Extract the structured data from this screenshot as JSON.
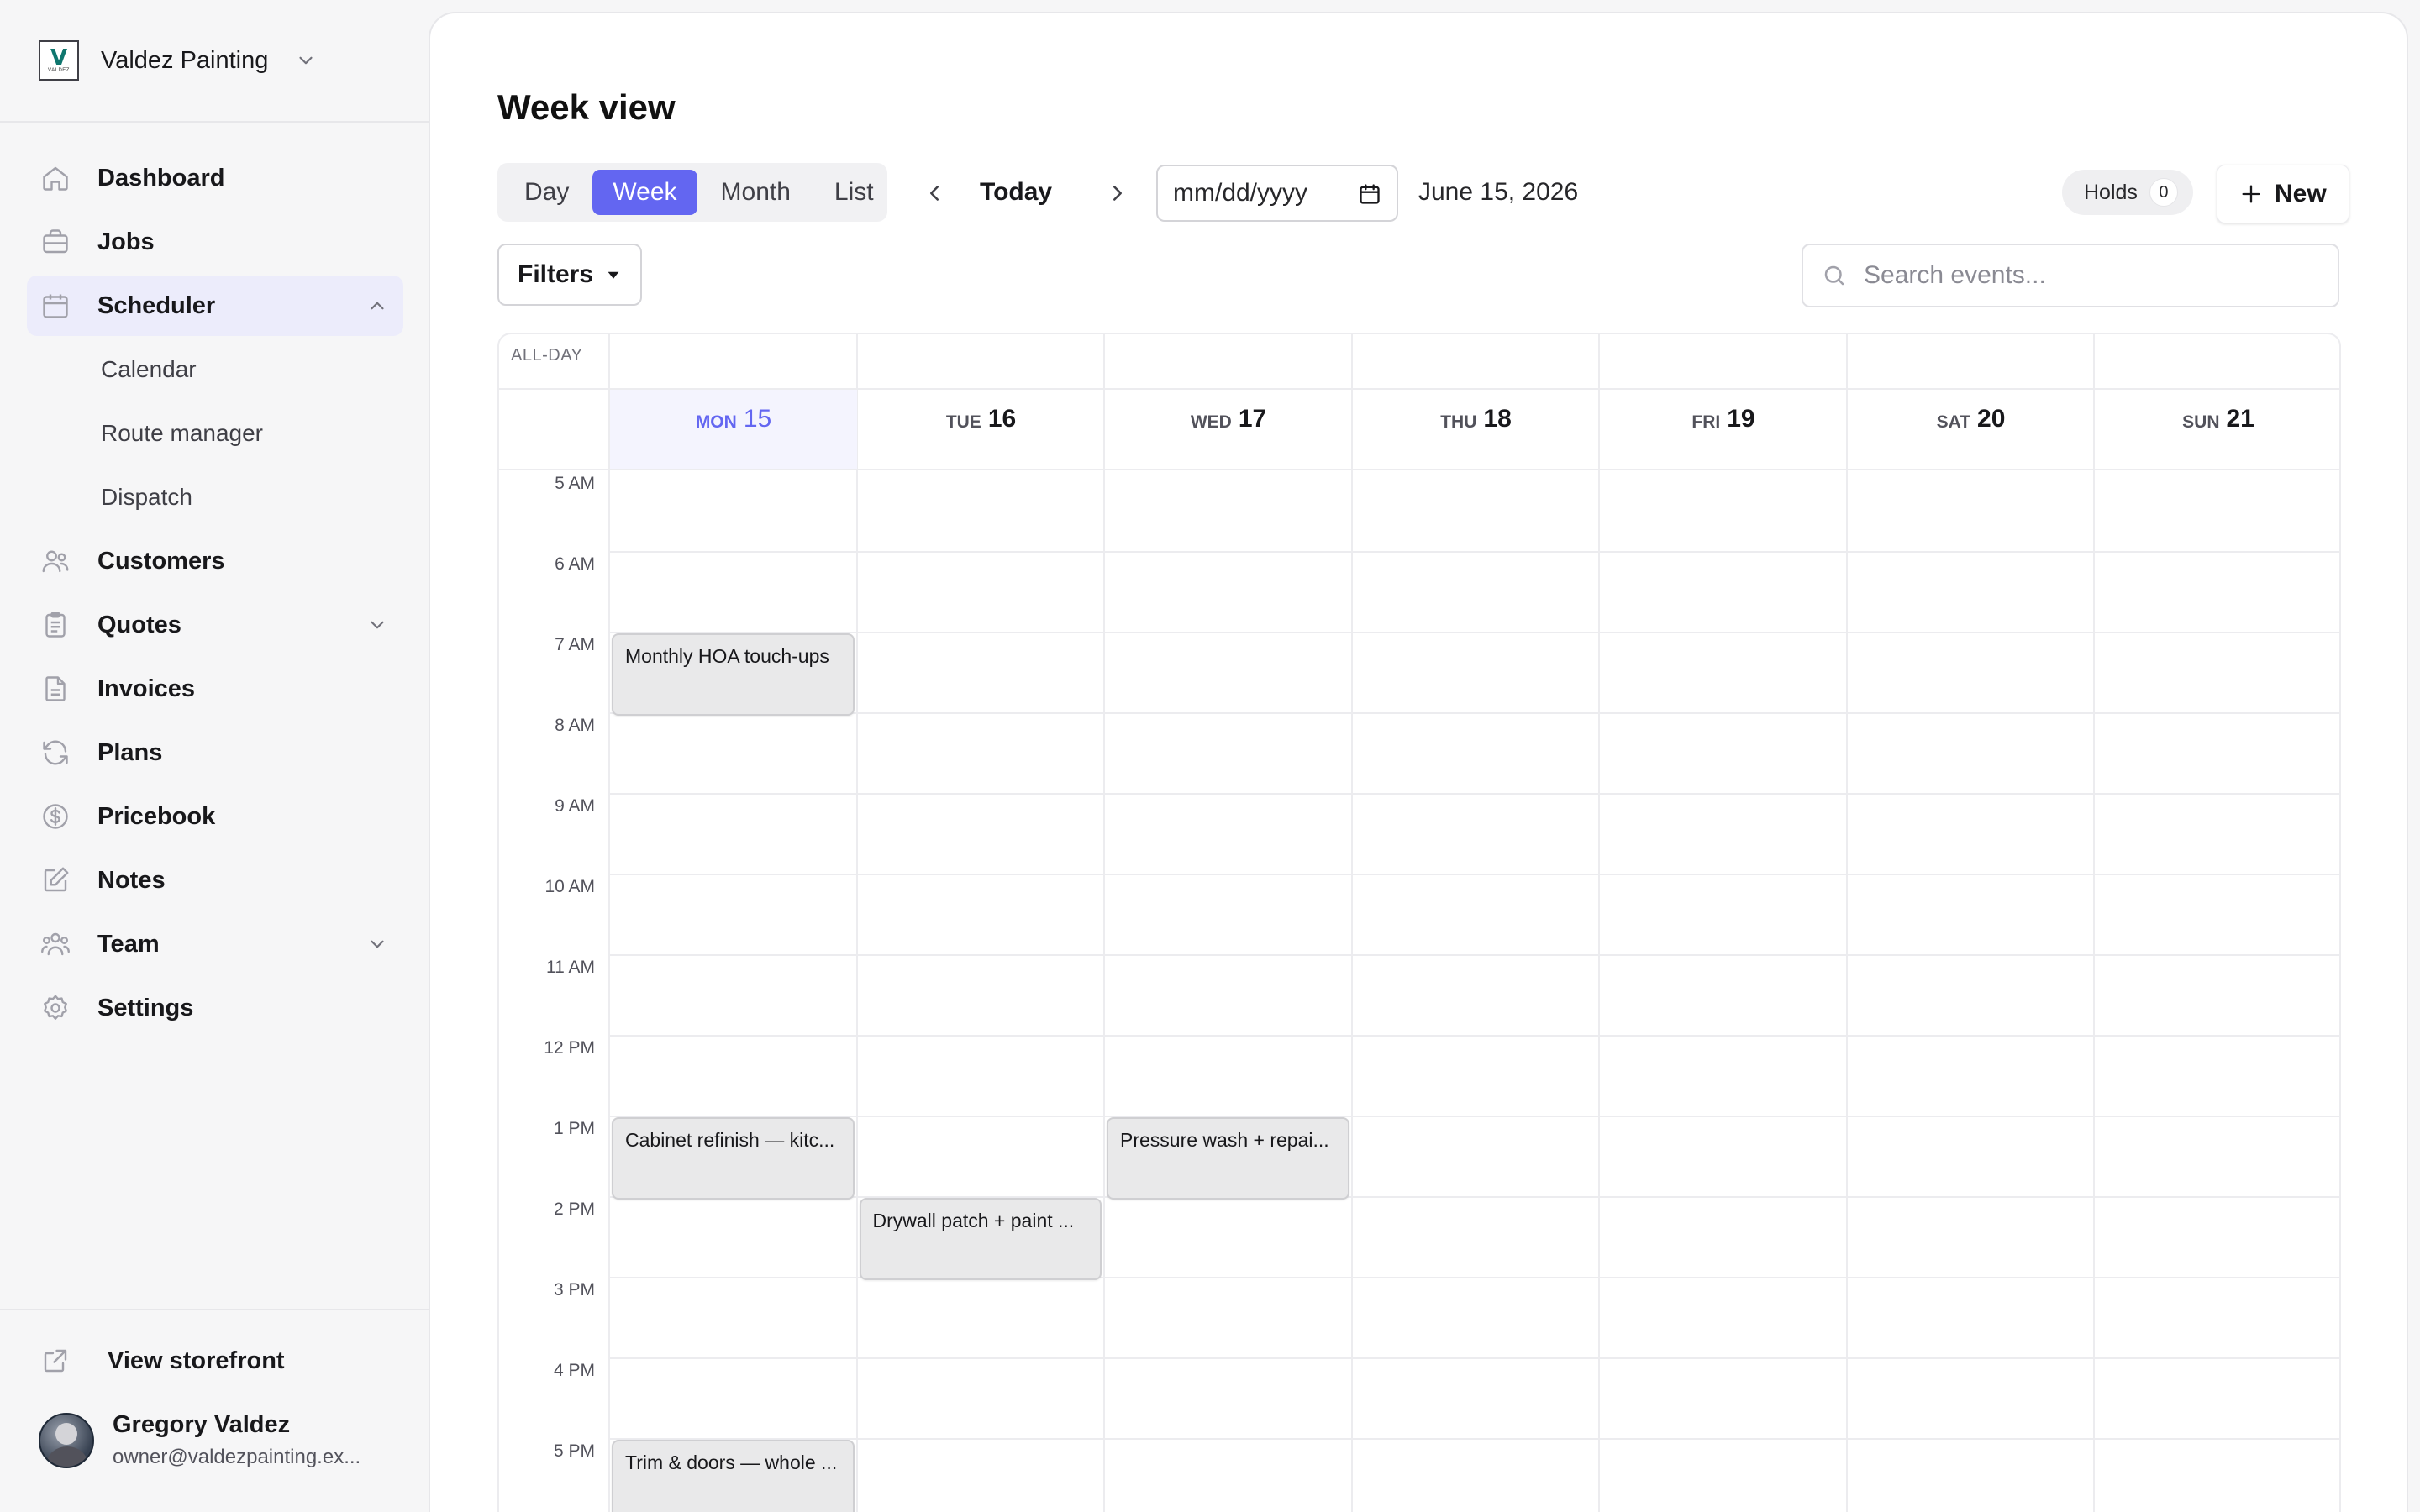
{
  "brand": {
    "name": "Valdez Painting",
    "logo_letter": "V",
    "logo_text": "VALDEZ"
  },
  "sidebar": {
    "items": [
      {
        "label": "Dashboard"
      },
      {
        "label": "Jobs"
      },
      {
        "label": "Scheduler"
      },
      {
        "label": "Customers"
      },
      {
        "label": "Quotes"
      },
      {
        "label": "Invoices"
      },
      {
        "label": "Plans"
      },
      {
        "label": "Pricebook"
      },
      {
        "label": "Notes"
      },
      {
        "label": "Team"
      },
      {
        "label": "Settings"
      }
    ],
    "scheduler_sub": [
      {
        "label": "Calendar"
      },
      {
        "label": "Route manager"
      },
      {
        "label": "Dispatch"
      }
    ],
    "storefront": "View storefront",
    "user": {
      "name": "Gregory Valdez",
      "email": "owner@valdezpainting.ex..."
    }
  },
  "main": {
    "title": "Week view",
    "views": [
      "Day",
      "Week",
      "Month",
      "List"
    ],
    "active_view": "Week",
    "today_label": "Today",
    "date_input_placeholder": "mm/dd/yyyy",
    "date_label": "June 15, 2026",
    "holds_label": "Holds",
    "holds_count": "0",
    "new_label": "New",
    "filters_label": "Filters",
    "search_placeholder": "Search events..."
  },
  "calendar": {
    "allday_label": "ALL-DAY",
    "days": [
      {
        "dow": "MON",
        "dom": "15",
        "today": true
      },
      {
        "dow": "TUE",
        "dom": "16",
        "today": false
      },
      {
        "dow": "WED",
        "dom": "17",
        "today": false
      },
      {
        "dow": "THU",
        "dom": "18",
        "today": false
      },
      {
        "dow": "FRI",
        "dom": "19",
        "today": false
      },
      {
        "dow": "SAT",
        "dom": "20",
        "today": false
      },
      {
        "dow": "SUN",
        "dom": "21",
        "today": false
      }
    ],
    "hours": [
      "5 AM",
      "6 AM",
      "7 AM",
      "8 AM",
      "9 AM",
      "10 AM",
      "11 AM",
      "12 PM",
      "1 PM",
      "2 PM",
      "3 PM",
      "4 PM",
      "5 PM"
    ],
    "events": [
      {
        "title": "Monthly HOA touch-ups",
        "day": "MON",
        "start": "7 AM"
      },
      {
        "title": "Cabinet refinish — kitc...",
        "day": "MON",
        "start": "1 PM"
      },
      {
        "title": "Drywall patch + paint ...",
        "day": "TUE",
        "start": "2 PM"
      },
      {
        "title": "Pressure wash + repai...",
        "day": "WED",
        "start": "1 PM"
      },
      {
        "title": "Trim & doors — whole ...",
        "day": "MON",
        "start": "5 PM"
      }
    ]
  }
}
